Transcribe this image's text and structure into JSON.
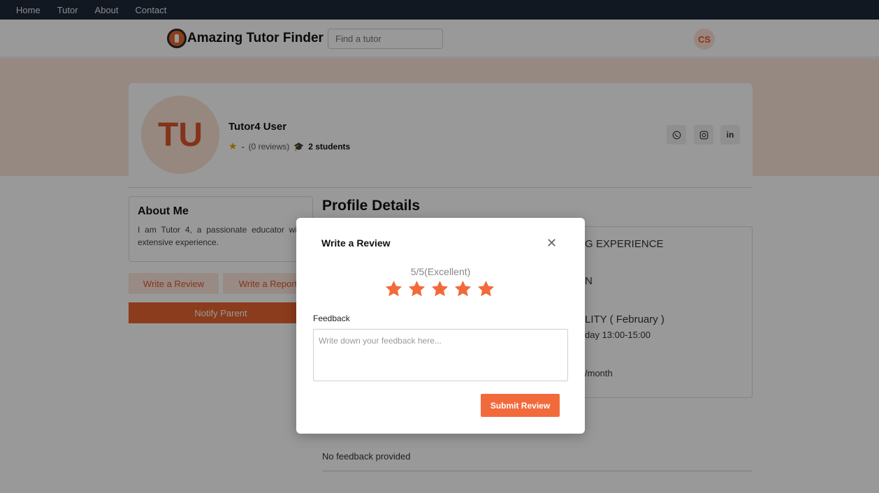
{
  "topnav": {
    "items": [
      "Home",
      "Tutor",
      "About",
      "Contact"
    ]
  },
  "header": {
    "brand": "Amazing Tutor Finder",
    "search_placeholder": "Find a tutor",
    "user_initials": "CS"
  },
  "profile": {
    "initials": "TU",
    "name": "Tutor4 User",
    "rating": "-",
    "reviews": "(0 reviews)",
    "students": "2 students"
  },
  "about": {
    "title": "About Me",
    "text": "I am Tutor 4, a passionate educator with extensive experience."
  },
  "actions": {
    "write_review": "Write a Review",
    "write_report": "Write a Report",
    "notify_parent": "Notify Parent"
  },
  "details": {
    "title": "Profile Details",
    "fragments": [
      "G EXPERIENCE",
      "N",
      "LITY ( February )",
      "day 13:00-15:00",
      "/month"
    ],
    "no_feedback": "No feedback provided"
  },
  "modal": {
    "title": "Write a Review",
    "rating_text": "5/5(Excellent)",
    "rating_value": 5,
    "rating_max": 5,
    "feedback_label": "Feedback",
    "feedback_placeholder": "Write down your feedback here...",
    "submit": "Submit Review"
  },
  "colors": {
    "accent": "#f26a3b",
    "star": "#f26a3b"
  }
}
